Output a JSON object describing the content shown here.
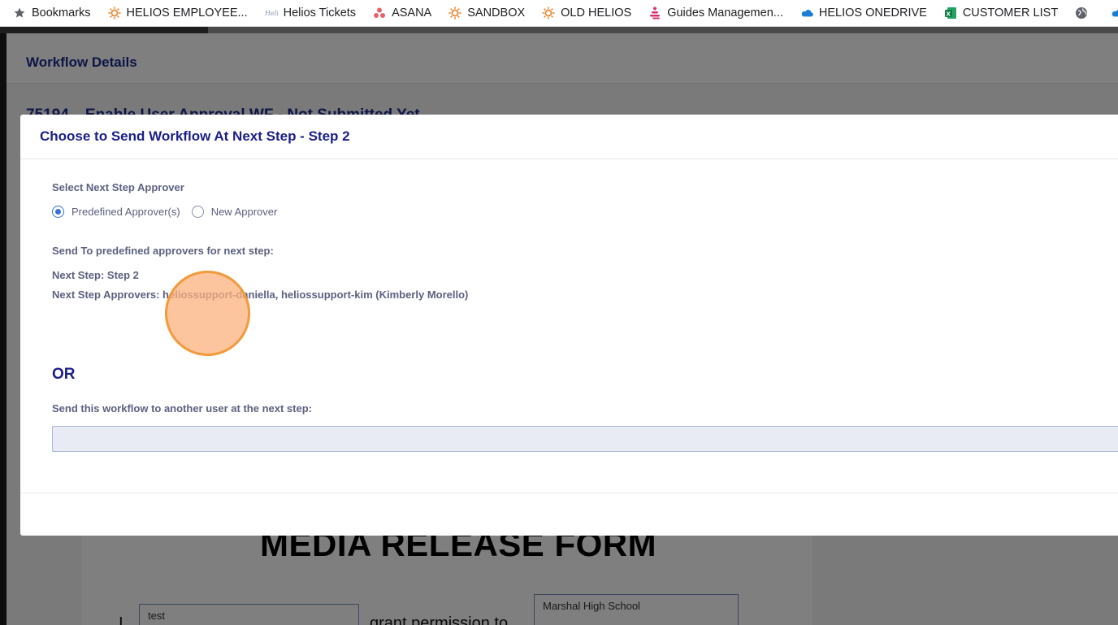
{
  "bookmarks": [
    {
      "label": "Bookmarks",
      "icon": "star-icon"
    },
    {
      "label": "HELIOS EMPLOYEE...",
      "icon": "sun-icon"
    },
    {
      "label": "Helios Tickets",
      "icon": "helios-logo-icon"
    },
    {
      "label": "ASANA",
      "icon": "asana-icon"
    },
    {
      "label": "SANDBOX",
      "icon": "sun-icon"
    },
    {
      "label": "OLD HELIOS",
      "icon": "sun-icon"
    },
    {
      "label": "Guides Managemen...",
      "icon": "guides-icon"
    },
    {
      "label": "HELIOS ONEDRIVE",
      "icon": "cloud-icon"
    },
    {
      "label": "CUSTOMER LIST",
      "icon": "excel-icon"
    },
    {
      "label": "",
      "icon": "globe-icon"
    },
    {
      "label": "",
      "icon": "cloud-icon"
    }
  ],
  "background": {
    "header_title": "Workflow Details",
    "subtitle": "75194   Enable User Approval WF - Not Submitted Yet",
    "doc_title": "MEDIA RELEASE FORM",
    "field_name_value": "test",
    "field_school_value": "Marshal High School",
    "doc_text_prefix": "I",
    "doc_text_middle": "grant permission to"
  },
  "modal": {
    "title": "Choose to Send Workflow At Next Step - Step 2",
    "select_label": "Select Next Step Approver",
    "radio_predefined": "Predefined Approver(s)",
    "radio_new": "New Approver",
    "selected_option": "Predefined Approver(s)",
    "send_to_label": "Send To predefined approvers for next step:",
    "next_step": "Next Step: Step 2",
    "next_step_approvers": "Next Step Approvers: heliossupport-daniella, heliossupport-kim (Kimberly Morello)",
    "or_label": "OR",
    "another_user_label": "Send this workflow to another user at the next step:",
    "another_user_value": ""
  },
  "colors": {
    "accent": "#1b1f8a",
    "radio_selected": "#3a6fd8",
    "click_indicator": "#f39a3a"
  }
}
